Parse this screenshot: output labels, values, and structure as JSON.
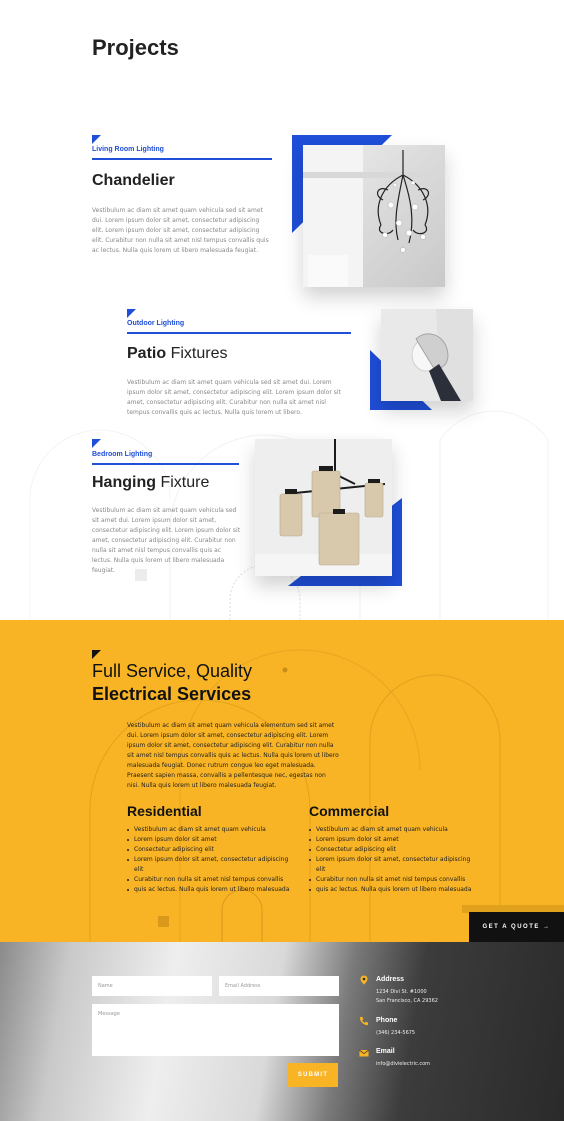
{
  "page": {
    "title": "Projects"
  },
  "projects": [
    {
      "category": "Living Room Lighting",
      "title_bold": "Chandelier",
      "title_light": "",
      "description": "Vestibulum ac diam sit amet quam vehicula sed sit amet dui. Lorem ipsum dolor sit amet, consectetur adipiscing elit. Lorem ipsum dolor sit amet, consectetur adipiscing elit. Curabitur non nulla sit amet nisl tempus convallis quis ac lectus. Nulla quis lorem ut libero malesuada feugiat."
    },
    {
      "category": "Outdoor Lighting",
      "title_bold": "Patio",
      "title_light": "Fixtures",
      "description": "Vestibulum ac diam sit amet quam vehicula sed sit amet dui. Lorem ipsum dolor sit amet, consectetur adipiscing elit. Lorem ipsum dolor sit amet, consectetur adipiscing elit. Curabitur non nulla sit amet nisl tempus convallis quis ac lectus. Nulla quis lorem ut libero."
    },
    {
      "category": "Bedroom Lighting",
      "title_bold": "Hanging",
      "title_light": "Fixture",
      "description": "Vestibulum ac diam sit amet quam vehicula sed sit amet dui. Lorem ipsum dolor sit amet, consectetur adipiscing elit. Lorem ipsum dolor sit amet, consectetur adipiscing elit. Curabitur non nulla sit amet nisl tempus convallis quis ac lectus. Nulla quis lorem ut libero malesuada feugiat."
    }
  ],
  "services": {
    "title_line1": "Full Service, Quality",
    "title_line2": "Electrical Services",
    "description": "Vestibulum ac diam sit amet quam vehicula elementum sed sit amet dui. Lorem ipsum dolor sit amet, consectetur adipiscing elit. Lorem ipsum dolor sit amet, consectetur adipiscing elit. Curabitur non nulla sit amet nisl tempus convallis quis ac lectus. Nulla quis lorem ut libero malesuada feugiat. Donec rutrum congue leo eget malesuada. Praesent sapien massa, convallis a pellentesque nec, egestas non nisi. Nulla quis lorem ut libero malesuada feugiat.",
    "columns": [
      {
        "title": "Residential",
        "items": [
          "Vestibulum ac diam sit amet quam vehicula",
          "Lorem ipsum dolor sit amet",
          "Consectetur adipiscing elit",
          "Lorem ipsum dolor sit amet, consectetur adipiscing elit",
          "Curabitur non nulla sit amet nisl tempus convallis",
          "quis ac lectus. Nulla quis lorem ut libero malesuada"
        ]
      },
      {
        "title": "Commercial",
        "items": [
          "Vestibulum ac diam sit amet quam vehicula",
          "Lorem ipsum dolor sit amet",
          "Consectetur adipiscing elit",
          "Lorem ipsum dolor sit amet, consectetur adipiscing elit",
          "Curabitur non nulla sit amet nisl tempus convallis",
          "quis ac lectus. Nulla quis lorem ut libero malesuada"
        ]
      }
    ],
    "quote_button": "GET A QUOTE →"
  },
  "contact": {
    "name_placeholder": "Name",
    "email_placeholder": "Email Address",
    "message_placeholder": "Message",
    "submit_label": "SUBMIT",
    "address_label": "Address",
    "address_line1": "1234 Divi St. #1000",
    "address_line2": "San Francisco, CA 29362",
    "phone_label": "Phone",
    "phone_value": "(346) 234-5675",
    "email_label": "Email",
    "email_value": "info@divielectric.com"
  },
  "colors": {
    "accent_blue": "#1f4ed8",
    "accent_yellow": "#f8b425",
    "dark": "#111111"
  }
}
